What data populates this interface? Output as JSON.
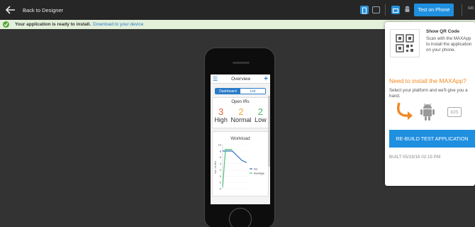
{
  "topbar": {
    "back_label": "Back to Designer",
    "test_on_phone_label": "Test on Phone",
    "user_label": "teb"
  },
  "notice": {
    "message": "Your application is ready to install.",
    "link_text": "Download to your device"
  },
  "app": {
    "header_title": "Overview",
    "tabs": [
      "Dashboard",
      "List"
    ],
    "open_irs_title": "Open IRs",
    "irs": [
      {
        "count": "3",
        "label": "High",
        "color": "#e8603c"
      },
      {
        "count": "2",
        "label": "Normal",
        "color": "#f0a83a"
      },
      {
        "count": "2",
        "label": "Low",
        "color": "#4fb36b"
      }
    ],
    "workload_title": "Workload"
  },
  "chart_data": {
    "type": "line",
    "title": "Workload",
    "ylabel": "No. of IRs",
    "xlabel": "",
    "ylim": [
      -4,
      10
    ],
    "yticks": [
      "10",
      "8",
      "6",
      "4",
      "2",
      "0",
      "-2",
      "-4"
    ],
    "series": [
      {
        "name": "ircr",
        "color": "#2a6bbd",
        "points": [
          [
            0,
            8
          ],
          [
            0.4,
            8
          ],
          [
            0.8,
            5
          ],
          [
            1,
            4.3
          ]
        ]
      },
      {
        "name": "Average",
        "color": "#4fc37a",
        "points": [
          [
            0,
            -3.5
          ],
          [
            0.12,
            8.5
          ],
          [
            0.4,
            8.5
          ]
        ]
      }
    ]
  },
  "panel": {
    "qr_title": "Show QR Code",
    "qr_text": "Scan with the MAXApp to install the application on your phone.",
    "need_title": "Need to install the MAXApp?",
    "select_text": "Select your platform and we'll give you a hand.",
    "ios_label": "iOS",
    "rebuild_label": "RE-BUILD TEST APPLICATION",
    "built_text": "BUILT 05/19/16 02:15 PM"
  }
}
